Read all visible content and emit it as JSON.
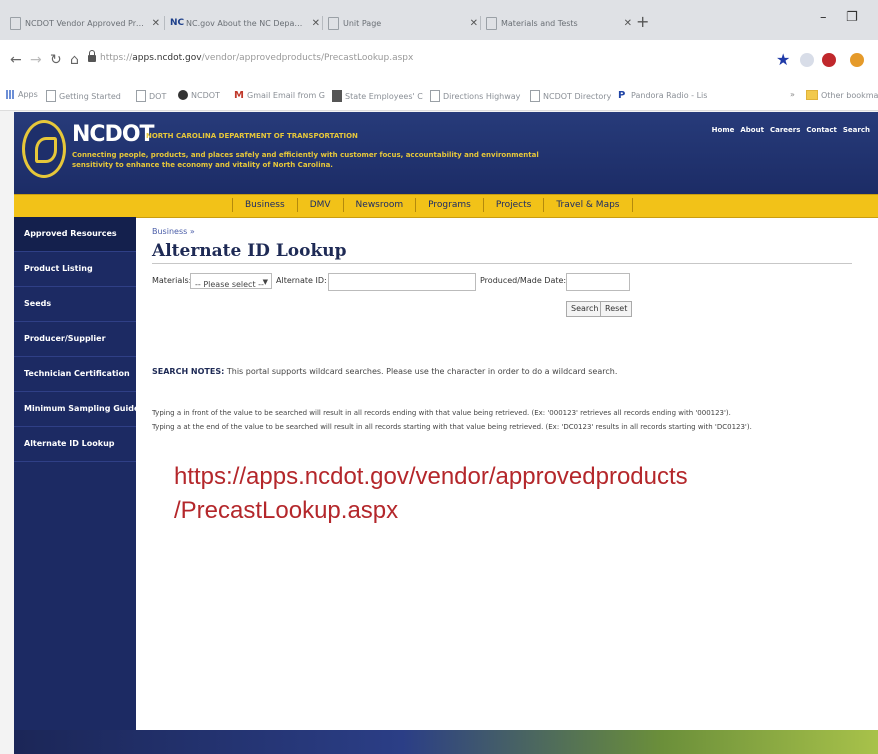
{
  "browser": {
    "tabs": [
      {
        "title": "NCDOT Vendor Approved Prod",
        "favicon": "page-icon"
      },
      {
        "title": "NC.gov About the NC Departm",
        "favicon": "nc-icon"
      },
      {
        "title": "Unit Page",
        "favicon": "page-icon"
      },
      {
        "title": "Materials and Tests",
        "favicon": "page-icon"
      }
    ],
    "url_scheme": "https://",
    "url_host": "apps.ncdot.gov",
    "url_path": "/vendor/approvedproducts/PrecastLookup.aspx",
    "bookmarks": [
      {
        "label": "Apps",
        "icon": "apps-grid-icon"
      },
      {
        "label": "Getting Started",
        "icon": "page-icon"
      },
      {
        "label": "DOT",
        "icon": "page-icon"
      },
      {
        "label": "NCDOT",
        "icon": "nc-icon"
      },
      {
        "label": "Gmail Email from G",
        "icon": "gmail-icon"
      },
      {
        "label": "State Employees' C",
        "icon": "folder-icon"
      },
      {
        "label": "Directions Highway",
        "icon": "page-icon"
      },
      {
        "label": "NCDOT Directory",
        "icon": "page-icon"
      },
      {
        "label": "Pandora Radio - Lis",
        "icon": "pandora-icon"
      },
      {
        "label": "Other bookmarks",
        "icon": "folder-icon"
      }
    ]
  },
  "site": {
    "brand": "NCDOT",
    "department": "NORTH CAROLINA DEPARTMENT OF TRANSPORTATION",
    "tagline": "Connecting people, products, and places safely and efficiently with customer focus, accountability and environmental sensitivity to enhance the economy and vitality of North Carolina.",
    "top_links": [
      "Home",
      "About",
      "Careers",
      "Contact",
      "Search"
    ],
    "menu": [
      "Business",
      "DMV",
      "Newsroom",
      "Programs",
      "Projects",
      "Travel & Maps"
    ]
  },
  "sidebar": {
    "items": [
      "Approved Resources",
      "Product Listing",
      "Seeds",
      "Producer/Supplier",
      "Technician Certification",
      "Minimum Sampling Guide",
      "Alternate ID Lookup"
    ]
  },
  "main": {
    "breadcrumb": "Business »",
    "title": "Alternate ID Lookup",
    "form": {
      "materials_label": "Materials:",
      "materials_value": "-- Please select --",
      "alternate_id_label": "Alternate ID:",
      "alternate_id_value": "",
      "produced_label": "Produced/Made Date:",
      "produced_value": "",
      "search_label": "Search",
      "reset_label": "Reset"
    },
    "notes_heading": "SEARCH NOTES:",
    "notes_text": "This portal supports wildcard searches. Please use the character in order to do a wildcard search.",
    "note_line_1": "Typing a in front of the value to be searched will result in all records ending with that value being retrieved. (Ex: '000123' retrieves all records ending with '000123').",
    "note_line_2": "Typing a at the end of the value to be searched will result in all records starting with that value being retrieved. (Ex: 'DC0123' results in all records starting with 'DC0123')."
  },
  "annotation": {
    "line1": "https://apps.ncdot.gov/vendor/approvedproducts",
    "line2": "/PrecastLookup.aspx"
  },
  "colors": {
    "header_navy": "#1c2c66",
    "menu_gold": "#f2c218",
    "annotation_red": "#b4272b"
  }
}
